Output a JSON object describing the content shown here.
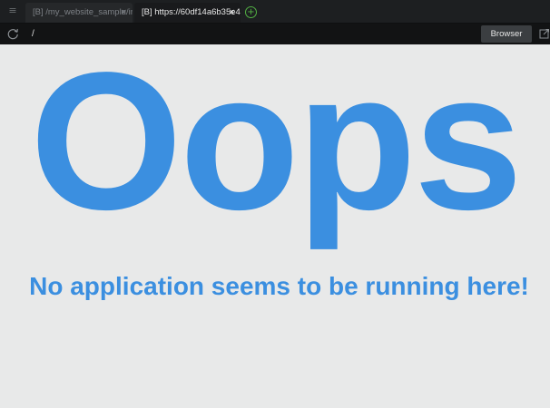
{
  "tabs": [
    {
      "label": "[B] /my_website_sample/in",
      "close": "×",
      "active": false
    },
    {
      "label": "[B] https://60df14a6b35e4",
      "close": "×",
      "active": true
    }
  ],
  "new_tab": "+",
  "address": {
    "url": "/",
    "browser_button": "Browser"
  },
  "page": {
    "heading": "Oops",
    "message": "No application seems to be running here!"
  },
  "colors": {
    "accent": "#3b8fe0",
    "page_background": "#e8e9e9",
    "toolbar": "#1d1f21",
    "new_tab": "#52b043"
  },
  "icons": {
    "menu": "menu-icon",
    "refresh": "refresh-icon",
    "popout": "popout-icon",
    "new_tab": "plus-circle-icon"
  }
}
